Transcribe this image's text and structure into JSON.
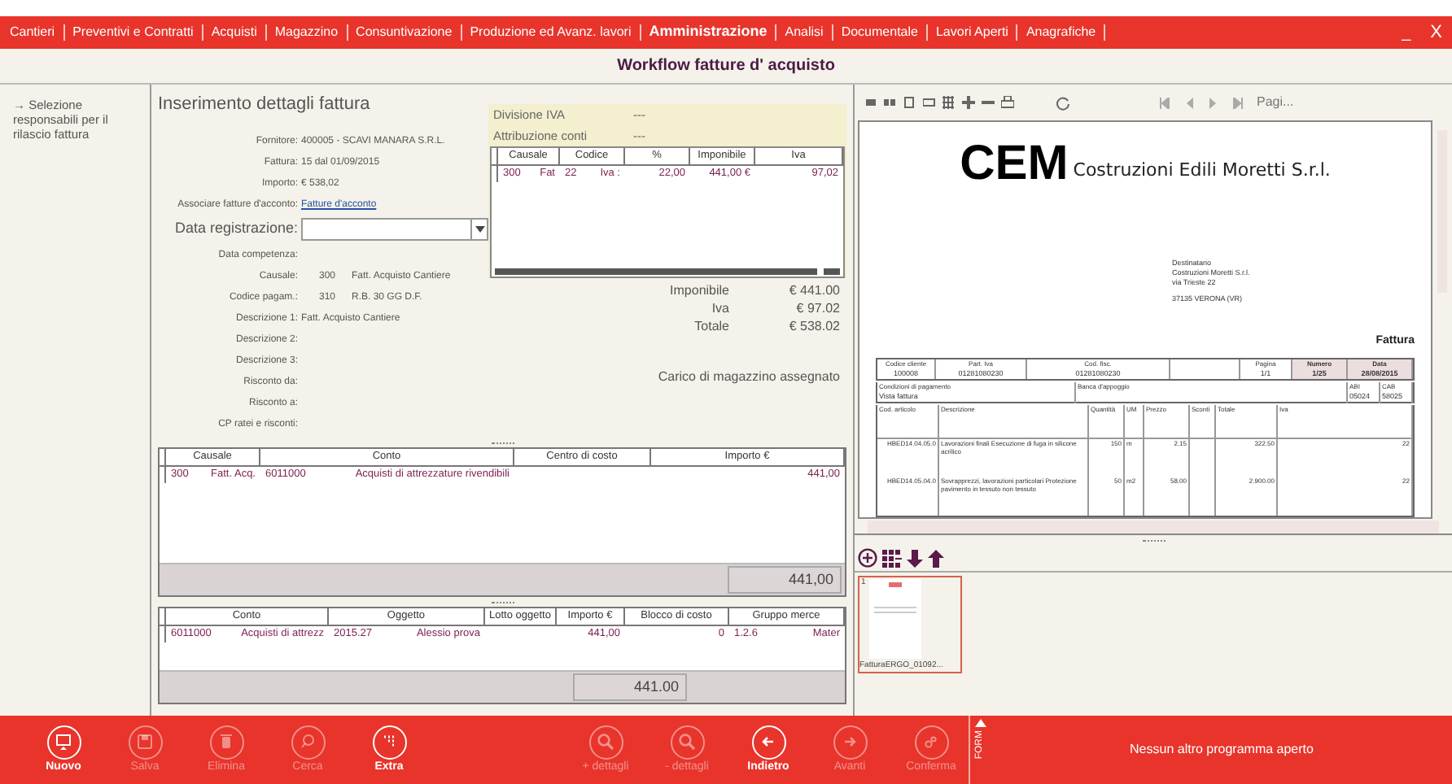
{
  "window": {
    "minimize": "_",
    "close": "X"
  },
  "menu": [
    {
      "label": "Cantieri",
      "selected": false
    },
    {
      "label": "Preventivi e Contratti",
      "selected": false
    },
    {
      "label": "Acquisti",
      "selected": false
    },
    {
      "label": "Magazzino",
      "selected": false
    },
    {
      "label": "Consuntivazione",
      "selected": false
    },
    {
      "label": "Produzione ed Avanz. lavori",
      "selected": false
    },
    {
      "label": "Amministrazione",
      "selected": true
    },
    {
      "label": "Analisi",
      "selected": false
    },
    {
      "label": "Documentale",
      "selected": false
    },
    {
      "label": "Lavori Aperti",
      "selected": false
    },
    {
      "label": "Anagrafiche",
      "selected": false
    }
  ],
  "page_title": "Workflow fatture d' acquisto",
  "sidebar": {
    "items": [
      "→ Selezione responsabili per il rilascio fattura"
    ]
  },
  "form": {
    "title": "Inserimento dettagli fattura",
    "fields": [
      {
        "kind": "text",
        "label": "Fornitore:",
        "value": "400005 - SCAVI MANARA S.R.L."
      },
      {
        "kind": "text",
        "label": "Fattura:",
        "value": "15 dal 01/09/2015"
      },
      {
        "kind": "text",
        "label": "Importo:",
        "value": "€ 538,02"
      },
      {
        "kind": "link",
        "label": "Associare fatture d'acconto:",
        "value": "Fatture d'acconto"
      },
      {
        "kind": "dropdown",
        "label": "Data registrazione:"
      },
      {
        "kind": "text",
        "label": "Data competenza:"
      },
      {
        "kind": "code",
        "label": "Causale:",
        "code": "300",
        "value": "Fatt. Acquisto Cantiere"
      },
      {
        "kind": "code",
        "label": "Codice pagam.:",
        "code": "310",
        "value": "R.B. 30 GG D.F."
      },
      {
        "kind": "text",
        "label": "Descrizione 1:",
        "value": "Fatt. Acquisto Cantiere"
      },
      {
        "kind": "text",
        "label": "Descrizione 2:"
      },
      {
        "kind": "text",
        "label": "Descrizione 3:"
      },
      {
        "kind": "text",
        "label": "Risconto da:"
      },
      {
        "kind": "text",
        "label": "Risconto a:"
      },
      {
        "kind": "text",
        "label": "CP ratei e risconti:"
      }
    ]
  },
  "iva_panel": {
    "rows": [
      {
        "label": "Divisione IVA",
        "value": "---"
      },
      {
        "label": "Attribuzione conti",
        "value": "---"
      }
    ],
    "table": {
      "columns": [
        "Causale",
        "Codice",
        "%",
        "Imponibile",
        "Iva"
      ],
      "rows": [
        [
          [
            "300",
            "Fat"
          ],
          [
            "22",
            "Iva :"
          ],
          [
            "22,00"
          ],
          [
            "441,00 €"
          ],
          [
            "97,02"
          ]
        ]
      ]
    },
    "totals": [
      {
        "label": "Imponibile",
        "value": "€ 441.00"
      },
      {
        "label": "Iva",
        "value": "€ 97.02"
      },
      {
        "label": "Totale",
        "value": "€ 538.02"
      }
    ],
    "note": "Carico di magazzino assegnato"
  },
  "accounts_table": {
    "columns": [
      "Causale",
      "Conto",
      "Centro di costo",
      "Importo €"
    ],
    "rows": [
      [
        [
          "300",
          "Fatt. Acq."
        ],
        [
          "6011000",
          "Acquisti di attrezzature rivendibili"
        ],
        null,
        [
          "441,00"
        ]
      ]
    ],
    "total": "441,00"
  },
  "items_table": {
    "columns": [
      "Conto",
      "Oggetto",
      "Lotto oggetto",
      "Importo €",
      "Blocco di costo",
      "Gruppo merce"
    ],
    "rows": [
      [
        [
          "6011000",
          "Acquisti di attrezz"
        ],
        [
          "2015.27",
          "Alessio prova"
        ],
        null,
        [
          "441,00"
        ],
        [
          "0"
        ],
        [
          "1.2.6",
          "Mater"
        ]
      ]
    ],
    "total": "441.00"
  },
  "viewer": {
    "page_label": "Pagi...",
    "document": {
      "logo": "CEM",
      "company": "Costruzioni Edili Moretti S.r.l.",
      "recipient": [
        "Destinatario",
        "Costruzioni Moretti S.r.l.",
        "via Trieste 22",
        "37135 VERONA    (VR)"
      ],
      "doc_type": "Fattura",
      "header": [
        {
          "label": "Codice cliente",
          "value": "100008"
        },
        {
          "label": "Part. Iva",
          "value": "01281080230"
        },
        {
          "label": "Cod. fisc.",
          "value": "01281080230"
        },
        {
          "label": "Pagina",
          "value": "1/1"
        },
        {
          "label": "Numero",
          "value": "1/25"
        },
        {
          "label": "Data",
          "value": "28/08/2015"
        }
      ],
      "payment": [
        {
          "label": "Condizioni di pagamento",
          "value": "Vista fattura"
        },
        {
          "label": "Banca d'appoggio"
        },
        {
          "label": "ABI",
          "value": "05024"
        },
        {
          "label": "CAB",
          "value": "58025"
        }
      ],
      "columns": [
        "Cod. articolo",
        "Descrizione",
        "Quantità",
        "UM",
        "Prezzo",
        "Sconti",
        "Totale",
        "Iva"
      ],
      "rows": [
        [
          "HBED14.04.05.0",
          "Lavorazioni finali Esecuzione di fuga in silicone acrilico",
          "150",
          "m",
          "2.15",
          null,
          "322.50",
          "22"
        ],
        [
          "HBED14.05.04.0",
          "Sovrapprezzi, lavorazioni particolari Protezione pavimento in tessuto non tessuto",
          "50",
          "m2",
          "58.00",
          null,
          "2.900.00",
          "22"
        ]
      ]
    }
  },
  "attachments": [
    {
      "number": "1",
      "name": "FatturaERGO_01092...",
      "selected": true
    }
  ],
  "toolbar": {
    "left": [
      {
        "kind": "new",
        "label": "Nuovo",
        "enabled": true
      },
      {
        "kind": "save",
        "label": "Salva",
        "enabled": false
      },
      {
        "kind": "delete",
        "label": "Elimina",
        "enabled": false
      },
      {
        "kind": "search",
        "label": "Cerca",
        "enabled": false
      },
      {
        "kind": "extra",
        "label": "Extra",
        "enabled": true
      }
    ],
    "right": [
      {
        "kind": "zoom-plus",
        "label": "+ dettagli",
        "enabled": false
      },
      {
        "kind": "zoom-minus",
        "label": "- dettagli",
        "enabled": false
      },
      {
        "kind": "back",
        "label": "Indietro",
        "enabled": true
      },
      {
        "kind": "forward",
        "label": "Avanti",
        "enabled": false
      },
      {
        "kind": "confirm",
        "label": "Conferma",
        "enabled": false
      }
    ]
  },
  "form_tab": "FORM",
  "status": "Nessun altro programma aperto"
}
